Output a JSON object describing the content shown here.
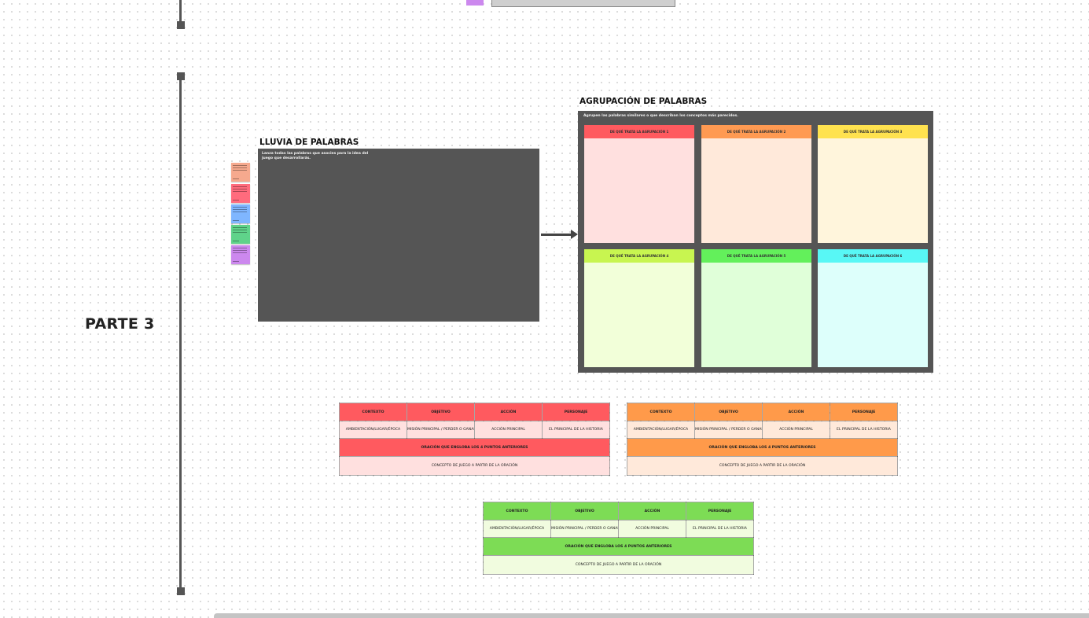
{
  "part_label": "PARTE 3",
  "brainstorm": {
    "title": "LLUVIA DE PALABRAS",
    "description": "Lanza todas las palabras que asocies para la idea del juego que desarrollarás."
  },
  "sticky_notes": [
    {
      "color": "#f6a98e"
    },
    {
      "color": "#ff6b7d"
    },
    {
      "color": "#7fb6ff"
    },
    {
      "color": "#5fd38a"
    },
    {
      "color": "#cc88ee"
    }
  ],
  "grouping": {
    "title": "AGRUPACIÓN DE PALABRAS",
    "description": "Agrupen las palabras similares o que describan los conceptos más parecidos.",
    "groups": [
      {
        "label": "DE QUÉ TRATA LA AGRUPACIÓN 1",
        "head_color": "#ff5a5f",
        "body_color": "#ffe0df"
      },
      {
        "label": "DE QUÉ TRATA LA AGRUPACIÓN 2",
        "head_color": "#ff9a52",
        "body_color": "#ffe9da"
      },
      {
        "label": "DE QUÉ TRATA LA AGRUPACIÓN 3",
        "head_color": "#ffe24f",
        "body_color": "#fff5dc"
      },
      {
        "label": "DE QUÉ TRATA LA AGRUPACIÓN 4",
        "head_color": "#c8f550",
        "body_color": "#f2ffd9"
      },
      {
        "label": "DE QUÉ TRATA LA AGRUPACIÓN 5",
        "head_color": "#63f05b",
        "body_color": "#e0ffd9"
      },
      {
        "label": "DE QUÉ TRATA LA AGRUPACIÓN 6",
        "head_color": "#58f7f5",
        "body_color": "#ddfffb"
      }
    ]
  },
  "concept_tables": [
    {
      "head_color": "#ff5a5f",
      "body_color": "#ffe0df",
      "headers": [
        "CONTEXTO",
        "OBJETIVO",
        "ACCIÓN",
        "PERSONAJE"
      ],
      "subs": [
        "AMBIENTACIÓN/LUGAR/ÉPOCA",
        "MISIÓN PRINCIPAL / PERDER O GANAR",
        "ACCIÓN PRINCIPAL",
        "EL PRINCIPAL DE LA HISTORIA"
      ],
      "sentence": "ORACIÓN QUE ENGLOBA LOS 4 PUNTOS ANTERIORES",
      "concept": "CONCEPTO DE JUEGO A PARTIR DE LA ORACIÓN"
    },
    {
      "head_color": "#ff9a4a",
      "body_color": "#ffe9da",
      "headers": [
        "CONTEXTO",
        "OBJETIVO",
        "ACCIÓN",
        "PERSONAJE"
      ],
      "subs": [
        "AMBIENTACIÓN/LUGAR/ÉPOCA",
        "MISIÓN PRINCIPAL / PERDER O GANAR",
        "ACCIÓN PRINCIPAL",
        "EL PRINCIPAL DE LA HISTORIA"
      ],
      "sentence": "ORACIÓN QUE ENGLOBA LOS 4 PUNTOS ANTERIORES",
      "concept": "CONCEPTO DE JUEGO A PARTIR DE LA ORACIÓN"
    },
    {
      "head_color": "#7ddc55",
      "body_color": "#f1fcdf",
      "headers": [
        "CONTEXTO",
        "OBJETIVO",
        "ACCIÓN",
        "PERSONAJE"
      ],
      "subs": [
        "AMBIENTACIÓN/LUGAR/ÉPOCA",
        "MISIÓN PRINCIPAL / PERDER O GANAR",
        "ACCIÓN PRINCIPAL",
        "EL PRINCIPAL DE LA HISTORIA"
      ],
      "sentence": "ORACIÓN QUE ENGLOBA LOS 4 PUNTOS ANTERIORES",
      "concept": "CONCEPTO DE JUEGO A PARTIR DE LA ORACIÓN"
    }
  ]
}
